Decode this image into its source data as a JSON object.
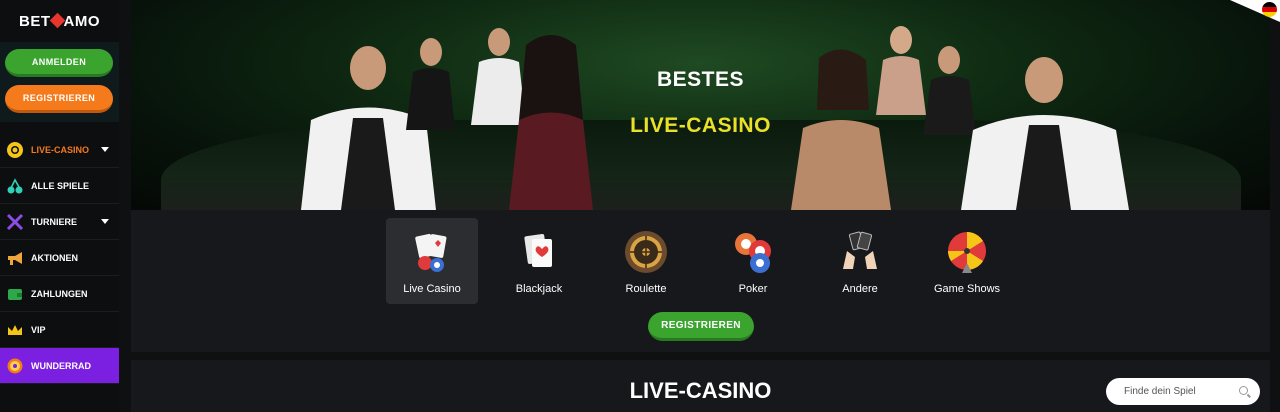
{
  "brand": {
    "logo_left": "BET",
    "logo_right": "AMO"
  },
  "auth": {
    "login_label": "ANMELDEN",
    "register_label": "REGISTRIEREN"
  },
  "sidebar": {
    "items": [
      {
        "label": "LIVE-CASINO",
        "icon": "poker-chip-icon",
        "active": true,
        "has_caret": true
      },
      {
        "label": "ALLE SPIELE",
        "icon": "cherries-icon",
        "active": false,
        "has_caret": false
      },
      {
        "label": "TURNIERE",
        "icon": "crossed-swords-icon",
        "active": false,
        "has_caret": true
      },
      {
        "label": "AKTIONEN",
        "icon": "megaphone-icon",
        "active": false,
        "has_caret": false
      },
      {
        "label": "ZAHLUNGEN",
        "icon": "wallet-icon",
        "active": false,
        "has_caret": false
      },
      {
        "label": "VIP",
        "icon": "crown-icon",
        "active": false,
        "has_caret": false
      },
      {
        "label": "WUNDERRAD",
        "icon": "wheel-icon",
        "active": false,
        "has_caret": false
      }
    ]
  },
  "hero": {
    "line1": "BESTES",
    "line2": "LIVE-CASINO"
  },
  "categories": [
    {
      "label": "Live Casino",
      "icon": "cards-chips-icon",
      "selected": true
    },
    {
      "label": "Blackjack",
      "icon": "playing-cards-icon",
      "selected": false
    },
    {
      "label": "Roulette",
      "icon": "roulette-wheel-icon",
      "selected": false
    },
    {
      "label": "Poker",
      "icon": "poker-chips-icon",
      "selected": false
    },
    {
      "label": "Andere",
      "icon": "hands-cards-icon",
      "selected": false
    },
    {
      "label": "Game Shows",
      "icon": "fortune-wheel-icon",
      "selected": false
    }
  ],
  "cta": {
    "register_label": "REGISTRIEREN"
  },
  "section": {
    "title": "LIVE-CASINO"
  },
  "search": {
    "placeholder": "Finde dein Spiel"
  },
  "colors": {
    "accent_green": "#3aa42f",
    "accent_orange": "#f47a1b",
    "hero_yellow": "#e9e02a",
    "highlight_purple": "#7b1fe0"
  },
  "language": {
    "flag": "germany-flag-icon"
  }
}
